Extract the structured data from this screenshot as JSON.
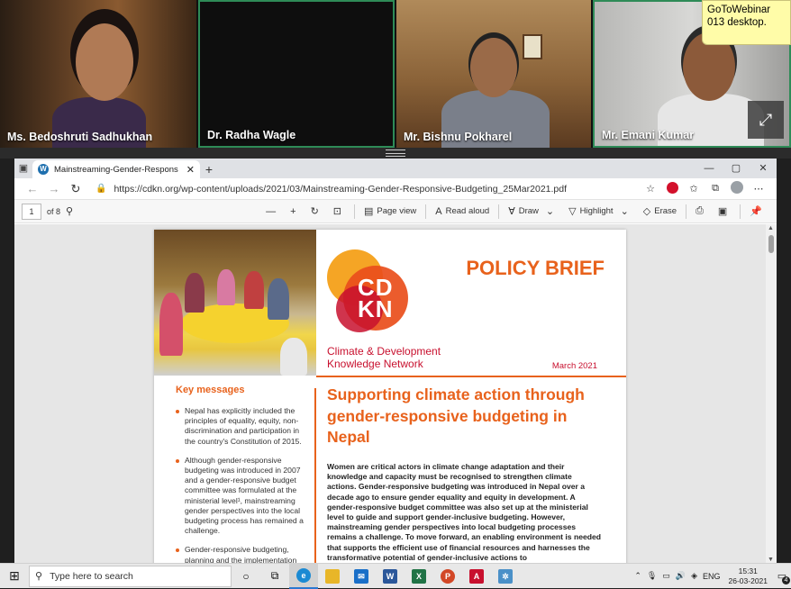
{
  "tooltip": {
    "text": "GoToWebinar 013 desktop."
  },
  "participants": [
    {
      "name": "Ms. Bedoshruti Sadhukhan"
    },
    {
      "name": "Dr. Radha Wagle"
    },
    {
      "name": "Mr. Bishnu Pokharel"
    },
    {
      "name": "Mr. Emani Kumar"
    }
  ],
  "browser": {
    "tab_title": "Mainstreaming-Gender-Respons",
    "tab_close": "✕",
    "new_tab": "+",
    "window_controls": [
      "—",
      "▢",
      "✕"
    ],
    "url": "https://cdkn.org/wp-content/uploads/2021/03/Mainstreaming-Gender-Responsive-Budgeting_25Mar2021.pdf"
  },
  "pdf_toolbar": {
    "page_number": "1",
    "page_of": "of 8",
    "page_view": "Page view",
    "read_aloud": "Read aloud",
    "draw": "Draw",
    "highlight": "Highlight",
    "erase": "Erase"
  },
  "document": {
    "policy_brief": "POLICY BRIEF",
    "logo_text_1": "CD",
    "logo_text_2": "KN",
    "org_name_line1": "Climate & Development",
    "org_name_line2": "Knowledge Network",
    "date": "March 2021",
    "key_heading": "Key messages",
    "key_messages": [
      "Nepal has explicitly included the principles of equality, equity, non-discrimination and participation in the country's Constitution of 2015.",
      "Although gender-responsive budgeting was introduced in 2007 and a gender-responsive budget committee was formulated at the ministerial level¹, mainstreaming gender perspectives into the local budgeting process has remained a challenge.",
      "Gender-responsive budgeting, planning and the implementation"
    ],
    "title": "Supporting climate action through gender-responsive budgeting in Nepal",
    "intro": "Women are critical actors in climate change adaptation and their knowledge and capacity must be recognised to strengthen climate actions. Gender-responsive budgeting was introduced in Nepal over a decade ago to ensure gender equality and equity in development. A gender-responsive budget committee was also set up at the ministerial level to guide and support gender-inclusive budgeting. However, mainstreaming gender perspectives into local budgeting processes remains a challenge. To move forward, an enabling environment is needed that supports the efficient use of financial resources and harnesses the transformative potential of gender-inclusive actions to"
  },
  "taskbar": {
    "search_placeholder": "Type here to search",
    "language": "ENG",
    "time": "15:31",
    "date": "26-03-2021",
    "notification_count": "4"
  },
  "colors": {
    "accent_orange": "#e8621c",
    "brand_red": "#c8102e",
    "active_border": "#2e8b57"
  }
}
